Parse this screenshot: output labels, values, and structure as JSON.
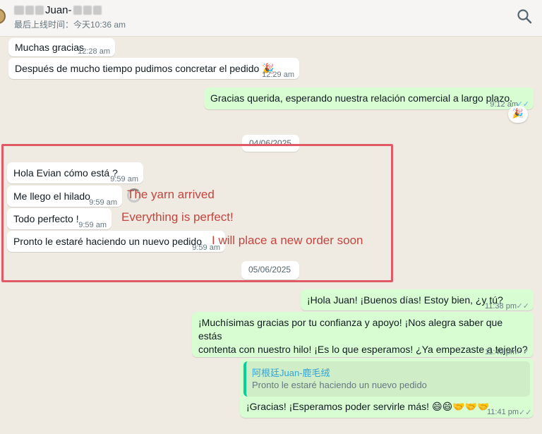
{
  "header": {
    "name": "Juan-",
    "last_seen": "最后上线时间：今天10:36 am"
  },
  "messages": [
    {
      "text": "Muchas gracias",
      "time": "12:28 am"
    },
    {
      "text": "Después de mucho tiempo pudimos concretar el pedido",
      "emoji": "🎉",
      "time": "12:29 am"
    },
    {
      "text": "Gracias querida, esperando nuestra relación comercial a largo plazo.",
      "time": "9:12 am",
      "reaction": "🎉"
    },
    {
      "text": "Hola Evian cómo está ?",
      "time": "9:59 am"
    },
    {
      "text": "Me llego el hilado",
      "time": "9:59 am"
    },
    {
      "text": "Todo perfecto !",
      "time": "9:59 am"
    },
    {
      "text": "Pronto le estaré haciendo un nuevo pedido",
      "time": "9:59 am"
    },
    {
      "text": "¡Hola Juan! ¡Buenos días! Estoy bien, ¿y tú?",
      "time": "11:38 pm"
    },
    {
      "line1": "¡Muchísimas gracias por tu confianza y apoyo! ¡Nos alegra saber que estás",
      "line2": "contenta con nuestro hilo! ¡Es lo que esperamos! ¿Ya empezaste a tejerlo?",
      "time": "11:40 pm"
    },
    {
      "text": "¡Gracias! ¡Esperamos poder servirle más!",
      "emoji": "😄😄🤝🤝🤝",
      "time": "11:41 pm"
    }
  ],
  "quote": {
    "author": "阿根廷Juan-鹿毛绒",
    "text": "Pronto le estaré haciendo un nuevo pedido"
  },
  "date_chips": [
    "04/06/2025",
    "05/06/2025"
  ],
  "annotations": [
    "The yarn arrived",
    "Everything is perfect!",
    "I will place a new order soon"
  ],
  "ticks": "✓✓"
}
